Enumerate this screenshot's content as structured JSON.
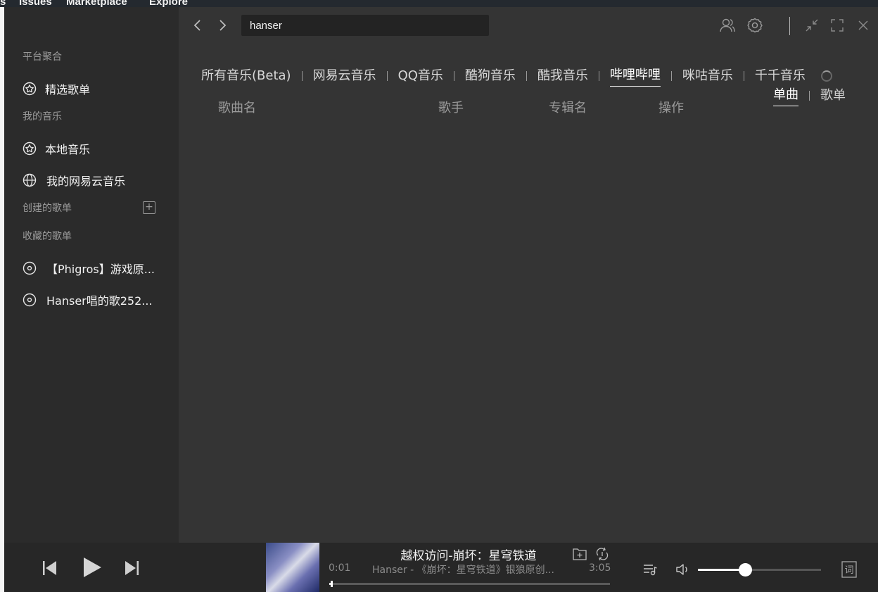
{
  "background_app": {
    "nav": [
      "s",
      "Issues",
      "Marketplace",
      "Explore"
    ]
  },
  "sidebar": {
    "sections": {
      "platform": "平台聚合",
      "my_music": "我的音乐",
      "created": "创建的歌单",
      "favorites": "收藏的歌单"
    },
    "platform_items": [
      {
        "label": "精选歌单",
        "icon": "star-icon"
      }
    ],
    "my_music_items": [
      {
        "label": "本地音乐",
        "icon": "star-icon"
      },
      {
        "label": "我的网易云音乐",
        "icon": "globe-icon"
      }
    ],
    "favorite_playlists": [
      {
        "label": "【Phigros】游戏原...",
        "icon": "disc-icon"
      },
      {
        "label": "Hanser唱的歌252...",
        "icon": "disc-icon"
      }
    ]
  },
  "header": {
    "search_value": "hanser"
  },
  "platform_tabs": [
    "所有音乐(Beta)",
    "网易云音乐",
    "QQ音乐",
    "酷狗音乐",
    "酷我音乐",
    "哔哩哔哩",
    "咪咕音乐",
    "千千音乐"
  ],
  "active_platform_tab": 5,
  "type_tabs": [
    "单曲",
    "歌单"
  ],
  "active_type_tab": 0,
  "columns": [
    "歌曲名",
    "歌手",
    "专辑名",
    "操作"
  ],
  "player": {
    "title": "越权访问-崩坏：星穹铁道",
    "artist_line": "Hanser - 《崩坏：星穹铁道》银狼原创...",
    "current_time": "0:01",
    "total_time": "3:05",
    "progress": 0.005,
    "volume": 0.38
  },
  "colors": {
    "app_bg": "#343434",
    "sidebar_bg": "#2b2b2b",
    "player_bg": "#272727",
    "accent": "#ffffff"
  }
}
